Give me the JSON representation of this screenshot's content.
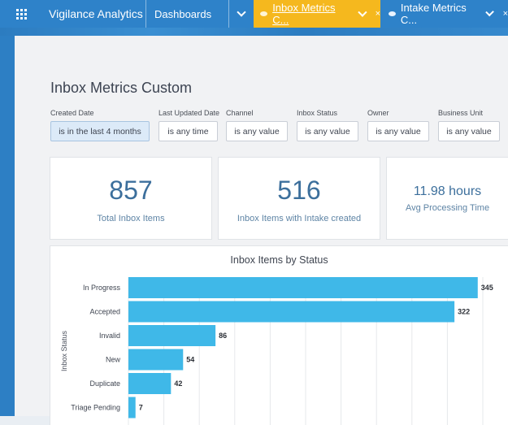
{
  "nav": {
    "app_name": "Vigilance Analytics",
    "dashboards": "Dashboards",
    "active_tab": "Inbox Metrics C...",
    "second_tab": "Intake Metrics C...",
    "close_glyph": "×"
  },
  "page": {
    "title": "Inbox Metrics Custom"
  },
  "filters": [
    {
      "label": "Created Date",
      "value": "is in the last 4 months"
    },
    {
      "label": "Last Updated Date",
      "value": "is any time"
    },
    {
      "label": "Channel",
      "value": "is any value"
    },
    {
      "label": "Inbox Status",
      "value": "is any value"
    },
    {
      "label": "Owner",
      "value": "is any value"
    },
    {
      "label": "Business Unit",
      "value": "is any value"
    }
  ],
  "kpis": [
    {
      "value": "857",
      "label": "Total Inbox Items"
    },
    {
      "value": "516",
      "label": "Inbox Items with Intake created"
    },
    {
      "value": "11.98 hours",
      "label": "Avg Processing Time"
    }
  ],
  "colors": {
    "nav": "#2e82c9",
    "active_tab": "#f5b81e",
    "bar": "#3fb8e8"
  },
  "chart_data": {
    "type": "bar",
    "orientation": "horizontal",
    "title": "Inbox Items by Status",
    "ylabel": "Inbox Status",
    "categories": [
      "In Progress",
      "Accepted",
      "Invalid",
      "New",
      "Duplicate",
      "Triage Pending"
    ],
    "values": [
      345,
      322,
      86,
      54,
      42,
      7
    ],
    "xlim": [
      0,
      350
    ],
    "grid": true
  }
}
